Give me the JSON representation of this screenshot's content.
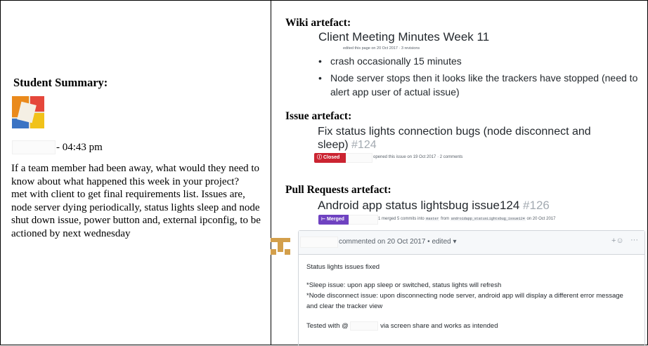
{
  "left": {
    "heading": "Student Summary:",
    "time": "- 04:43 pm",
    "question": "If a team member had been away, what would they need to know about what happened this week in your project?",
    "answer": "met with client to get final requirements list. Issues are, node server dying periodically, status lights sleep and node shut down issue, power button and, external ipconfig, to be actioned by next wednesday"
  },
  "wiki": {
    "label": "Wiki artefact:",
    "title": "Client Meeting Minutes Week 11",
    "edited": "edited this page on 20 Oct 2017 · 3 revisions",
    "bullets": [
      "crash occasionally 15 minutes",
      "Node server stops then it looks like the trackers have stopped (need to alert app user of actual issue)"
    ],
    "bullet_glyph": "•"
  },
  "issue": {
    "label": "Issue artefact:",
    "title": "Fix status lights connection bugs (node disconnect and sleep)",
    "number": "#124",
    "badge": "ⓘ Closed",
    "meta": "opened this issue on 19 Oct 2017 · 2 comments"
  },
  "pr": {
    "label": "Pull Requests artefact:",
    "title": "Android app status lightsbug issue124",
    "number": "#126",
    "badge": "⊢ Merged",
    "meta_prefix": "1 merged 5 commits into",
    "base_branch": "master",
    "from_word": "from",
    "head_branch": "androidapp_statusLightsbug_issue124",
    "meta_suffix": "on 20 Oct 2017"
  },
  "comment": {
    "header": "commented on 20 Oct 2017 • edited ▾",
    "react": "+☺",
    "more": "···",
    "lines": [
      "Status lights issues fixed",
      "*Sleep issue: upon app sleep or switched, status lights will refresh",
      "*Node disconnect issue: upon disconnecting node server, android app will display a different error message",
      "and clear the tracker view",
      "Tested with @",
      "via screen share and works as intended"
    ]
  },
  "colors": {
    "closed": "#cb2431",
    "merged": "#6f42c1",
    "identicon": "#d39f4b"
  }
}
